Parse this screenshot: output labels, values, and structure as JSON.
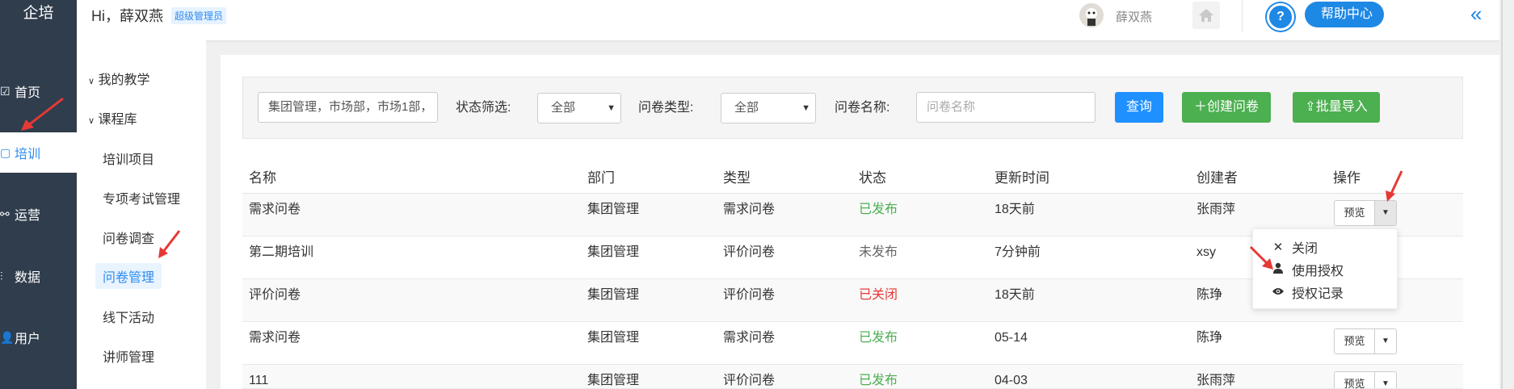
{
  "sidebar": {
    "brand": "企培",
    "items": [
      {
        "label": "首页",
        "icon": "☑"
      },
      {
        "label": "培训",
        "icon": "▢"
      },
      {
        "label": "运营",
        "icon": "⚯"
      },
      {
        "label": "数据",
        "icon": "⫶"
      },
      {
        "label": "用户",
        "icon": "👤"
      }
    ]
  },
  "submenu": {
    "groups": [
      "我的教学",
      "课程库"
    ],
    "items": [
      "培训项目",
      "专项考试管理",
      "问卷调查",
      "问卷管理",
      "线下活动",
      "讲师管理"
    ]
  },
  "header": {
    "greeting": "Hi，薛双燕",
    "role": "超级管理员",
    "username": "薛双燕",
    "help": "帮助中心"
  },
  "filter": {
    "dept_value": "集团管理，市场部，市场1部，",
    "status_label": "状态筛选:",
    "status_value": "全部",
    "type_label": "问卷类型:",
    "type_value": "全部",
    "name_label": "问卷名称:",
    "name_placeholder": "问卷名称",
    "query_btn": "查询",
    "create_btn": "＋创建问卷",
    "import_btn": "批量导入"
  },
  "table": {
    "headers": [
      "名称",
      "部门",
      "类型",
      "状态",
      "更新时间",
      "创建者",
      "操作"
    ],
    "rows": [
      {
        "name": "需求问卷",
        "dept": "集团管理",
        "type": "需求问卷",
        "status": "已发布",
        "status_kind": "pub",
        "updated": "18天前",
        "creator": "张雨萍"
      },
      {
        "name": "第二期培训",
        "dept": "集团管理",
        "type": "评价问卷",
        "status": "未发布",
        "status_kind": "unpub",
        "updated": "7分钟前",
        "creator": "xsy"
      },
      {
        "name": "评价问卷",
        "dept": "集团管理",
        "type": "评价问卷",
        "status": "已关闭",
        "status_kind": "closed",
        "updated": "18天前",
        "creator": "陈琤"
      },
      {
        "name": "需求问卷",
        "dept": "集团管理",
        "type": "需求问卷",
        "status": "已发布",
        "status_kind": "pub",
        "updated": "05-14",
        "creator": "陈琤"
      },
      {
        "name": "111",
        "dept": "集团管理",
        "type": "评价问卷",
        "status": "已发布",
        "status_kind": "pub",
        "updated": "04-03",
        "creator": "张雨萍"
      }
    ],
    "preview_label": "预览"
  },
  "dropdown": {
    "items": [
      "关闭",
      "使用授权",
      "授权记录"
    ]
  },
  "colors": {
    "sidebar_bg": "#2f3d4d",
    "accent": "#1e88e5",
    "published": "#4caf50",
    "closed": "#e53935",
    "annotation_arrow": "#e53935"
  }
}
